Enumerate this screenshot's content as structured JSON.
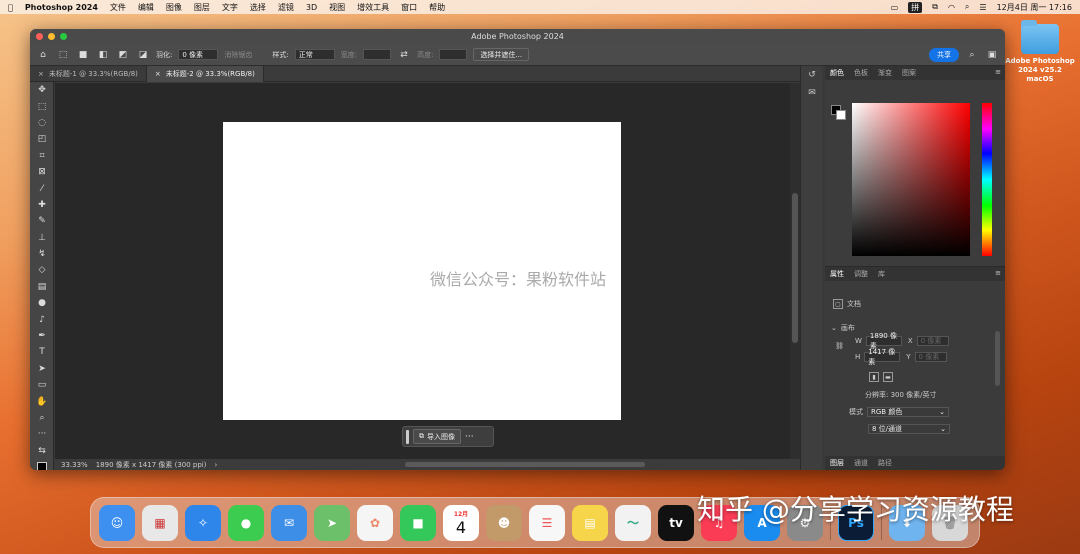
{
  "menubar": {
    "app": "Photoshop 2024",
    "items": [
      "文件",
      "编辑",
      "图像",
      "图层",
      "文字",
      "选择",
      "滤镜",
      "3D",
      "视图",
      "增效工具",
      "窗口",
      "帮助"
    ],
    "input_method": "拼",
    "datetime": "12月4日 周一  17:16"
  },
  "desktop_icon": {
    "line1": "Adobe Photoshop",
    "line2": "2024 v25.2 macOS"
  },
  "window": {
    "title": "Adobe Photoshop 2024"
  },
  "options": {
    "feather_label": "羽化:",
    "feather_value": "0 像素",
    "antialias": "消除锯齿",
    "style_label": "样式:",
    "style_value": "正常",
    "width_label": "宽度:",
    "height_label": "高度:",
    "select_mask": "选择并遮住...",
    "share": "共享"
  },
  "tabs": [
    {
      "label": "未标题-1 @ 33.3%(RGB/8)"
    },
    {
      "label": "未标题-2 @ 33.3%(RGB/8)"
    }
  ],
  "watermark": "微信公众号：果粉软件站",
  "context_bar": {
    "import": "导入图像",
    "more": "···"
  },
  "status": {
    "zoom": "33.33%",
    "info": "1890 像素 x 1417 像素 (300 ppi)",
    "arrow": "›"
  },
  "color_panel": {
    "tabs": [
      "颜色",
      "色板",
      "渐变",
      "图案"
    ],
    "fg_color": "#000000",
    "bg_color": "#ffffff"
  },
  "props_panel": {
    "tabs": [
      "属性",
      "调整",
      "库"
    ],
    "doc_label": "文档",
    "canvas_label": "画布",
    "w_label": "W",
    "w_value": "1890 像素",
    "x_label": "X",
    "x_placeholder": "0 像素",
    "h_label": "H",
    "h_value": "1417 像素",
    "y_label": "Y",
    "y_placeholder": "0 像素",
    "resolution": "分辨率: 300 像素/英寸",
    "mode_label": "模式",
    "mode_value": "RGB 颜色",
    "depth_value": "8 位/通道"
  },
  "bottom_tabs": [
    "图层",
    "通道",
    "路径"
  ],
  "dock": [
    {
      "name": "finder",
      "c": "#3d8ff0"
    },
    {
      "name": "launchpad",
      "c": "#e8e8e8"
    },
    {
      "name": "safari",
      "c": "#2f86ea"
    },
    {
      "name": "messages",
      "c": "#3ccc4f"
    },
    {
      "name": "mail",
      "c": "#3c8ee6"
    },
    {
      "name": "maps",
      "c": "#6cc06a"
    },
    {
      "name": "photos",
      "c": "#f5f5f5"
    },
    {
      "name": "facetime",
      "c": "#34c759"
    },
    {
      "name": "calendar",
      "c": "#ffffff"
    },
    {
      "name": "contacts",
      "c": "#c29a6a"
    },
    {
      "name": "reminders",
      "c": "#f7f7f7"
    },
    {
      "name": "notes",
      "c": "#f7d54a"
    },
    {
      "name": "freeform",
      "c": "#f2f2f2"
    },
    {
      "name": "tv",
      "c": "#111111"
    },
    {
      "name": "music",
      "c": "#fa3c55"
    },
    {
      "name": "appstore",
      "c": "#1a8cf0"
    },
    {
      "name": "settings",
      "c": "#8a8a8a"
    },
    {
      "name": "photoshop",
      "c": "#0b1d36"
    },
    {
      "name": "downloads",
      "c": "#6fb4ef"
    },
    {
      "name": "trash",
      "c": "#d8d8d8"
    }
  ],
  "dock_text": {
    "calendar_month": "12月",
    "calendar_day": "4",
    "tv": "tv",
    "ps": "Ps"
  },
  "zhihu_watermark": "知乎 @分享学习资源教程"
}
